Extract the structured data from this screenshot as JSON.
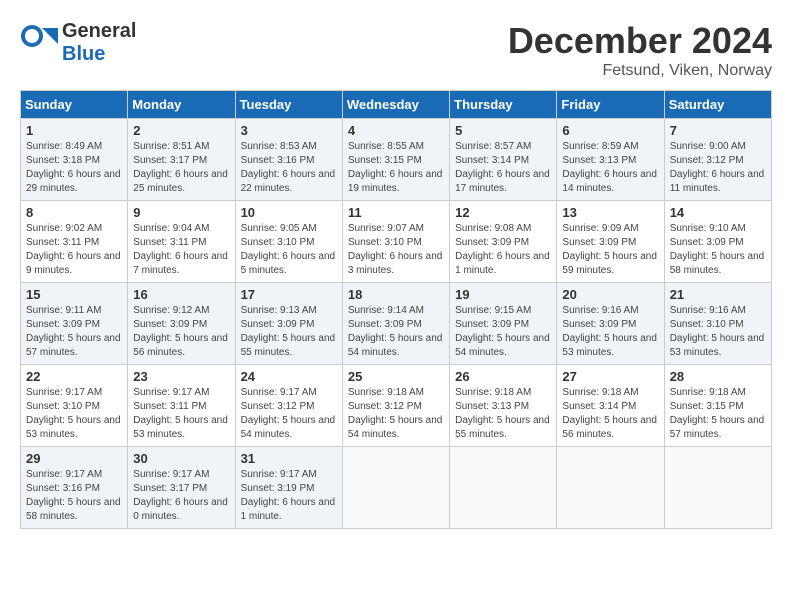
{
  "header": {
    "logo_general": "General",
    "logo_blue": "Blue",
    "month_title": "December 2024",
    "location": "Fetsund, Viken, Norway"
  },
  "days_of_week": [
    "Sunday",
    "Monday",
    "Tuesday",
    "Wednesday",
    "Thursday",
    "Friday",
    "Saturday"
  ],
  "weeks": [
    [
      {
        "day": "1",
        "sunrise": "8:49 AM",
        "sunset": "3:18 PM",
        "daylight": "6 hours and 29 minutes."
      },
      {
        "day": "2",
        "sunrise": "8:51 AM",
        "sunset": "3:17 PM",
        "daylight": "6 hours and 25 minutes."
      },
      {
        "day": "3",
        "sunrise": "8:53 AM",
        "sunset": "3:16 PM",
        "daylight": "6 hours and 22 minutes."
      },
      {
        "day": "4",
        "sunrise": "8:55 AM",
        "sunset": "3:15 PM",
        "daylight": "6 hours and 19 minutes."
      },
      {
        "day": "5",
        "sunrise": "8:57 AM",
        "sunset": "3:14 PM",
        "daylight": "6 hours and 17 minutes."
      },
      {
        "day": "6",
        "sunrise": "8:59 AM",
        "sunset": "3:13 PM",
        "daylight": "6 hours and 14 minutes."
      },
      {
        "day": "7",
        "sunrise": "9:00 AM",
        "sunset": "3:12 PM",
        "daylight": "6 hours and 11 minutes."
      }
    ],
    [
      {
        "day": "8",
        "sunrise": "9:02 AM",
        "sunset": "3:11 PM",
        "daylight": "6 hours and 9 minutes."
      },
      {
        "day": "9",
        "sunrise": "9:04 AM",
        "sunset": "3:11 PM",
        "daylight": "6 hours and 7 minutes."
      },
      {
        "day": "10",
        "sunrise": "9:05 AM",
        "sunset": "3:10 PM",
        "daylight": "6 hours and 5 minutes."
      },
      {
        "day": "11",
        "sunrise": "9:07 AM",
        "sunset": "3:10 PM",
        "daylight": "6 hours and 3 minutes."
      },
      {
        "day": "12",
        "sunrise": "9:08 AM",
        "sunset": "3:09 PM",
        "daylight": "6 hours and 1 minute."
      },
      {
        "day": "13",
        "sunrise": "9:09 AM",
        "sunset": "3:09 PM",
        "daylight": "5 hours and 59 minutes."
      },
      {
        "day": "14",
        "sunrise": "9:10 AM",
        "sunset": "3:09 PM",
        "daylight": "5 hours and 58 minutes."
      }
    ],
    [
      {
        "day": "15",
        "sunrise": "9:11 AM",
        "sunset": "3:09 PM",
        "daylight": "5 hours and 57 minutes."
      },
      {
        "day": "16",
        "sunrise": "9:12 AM",
        "sunset": "3:09 PM",
        "daylight": "5 hours and 56 minutes."
      },
      {
        "day": "17",
        "sunrise": "9:13 AM",
        "sunset": "3:09 PM",
        "daylight": "5 hours and 55 minutes."
      },
      {
        "day": "18",
        "sunrise": "9:14 AM",
        "sunset": "3:09 PM",
        "daylight": "5 hours and 54 minutes."
      },
      {
        "day": "19",
        "sunrise": "9:15 AM",
        "sunset": "3:09 PM",
        "daylight": "5 hours and 54 minutes."
      },
      {
        "day": "20",
        "sunrise": "9:16 AM",
        "sunset": "3:09 PM",
        "daylight": "5 hours and 53 minutes."
      },
      {
        "day": "21",
        "sunrise": "9:16 AM",
        "sunset": "3:10 PM",
        "daylight": "5 hours and 53 minutes."
      }
    ],
    [
      {
        "day": "22",
        "sunrise": "9:17 AM",
        "sunset": "3:10 PM",
        "daylight": "5 hours and 53 minutes."
      },
      {
        "day": "23",
        "sunrise": "9:17 AM",
        "sunset": "3:11 PM",
        "daylight": "5 hours and 53 minutes."
      },
      {
        "day": "24",
        "sunrise": "9:17 AM",
        "sunset": "3:12 PM",
        "daylight": "5 hours and 54 minutes."
      },
      {
        "day": "25",
        "sunrise": "9:18 AM",
        "sunset": "3:12 PM",
        "daylight": "5 hours and 54 minutes."
      },
      {
        "day": "26",
        "sunrise": "9:18 AM",
        "sunset": "3:13 PM",
        "daylight": "5 hours and 55 minutes."
      },
      {
        "day": "27",
        "sunrise": "9:18 AM",
        "sunset": "3:14 PM",
        "daylight": "5 hours and 56 minutes."
      },
      {
        "day": "28",
        "sunrise": "9:18 AM",
        "sunset": "3:15 PM",
        "daylight": "5 hours and 57 minutes."
      }
    ],
    [
      {
        "day": "29",
        "sunrise": "9:17 AM",
        "sunset": "3:16 PM",
        "daylight": "5 hours and 58 minutes."
      },
      {
        "day": "30",
        "sunrise": "9:17 AM",
        "sunset": "3:17 PM",
        "daylight": "6 hours and 0 minutes."
      },
      {
        "day": "31",
        "sunrise": "9:17 AM",
        "sunset": "3:19 PM",
        "daylight": "6 hours and 1 minute."
      },
      null,
      null,
      null,
      null
    ]
  ]
}
